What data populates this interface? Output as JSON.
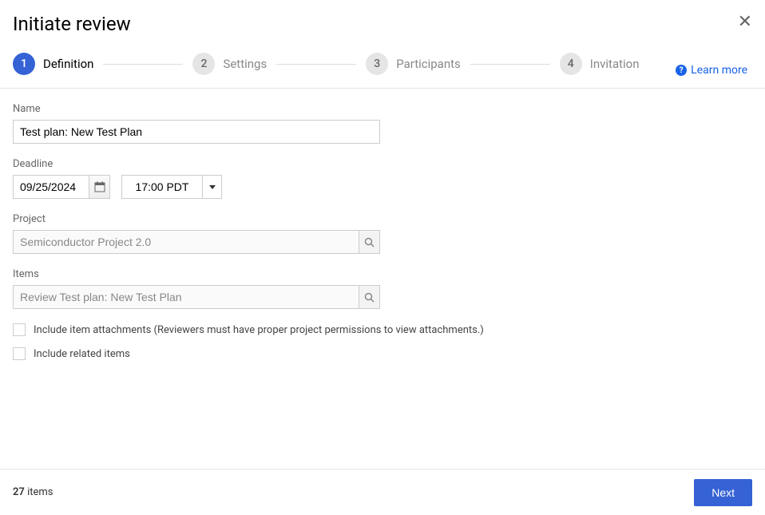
{
  "header": {
    "title": "Initiate review"
  },
  "stepper": {
    "steps": [
      {
        "num": "1",
        "label": "Definition",
        "active": true
      },
      {
        "num": "2",
        "label": "Settings",
        "active": false
      },
      {
        "num": "3",
        "label": "Participants",
        "active": false
      },
      {
        "num": "4",
        "label": "Invitation",
        "active": false
      }
    ],
    "learn_more": "Learn more"
  },
  "form": {
    "name_label": "Name",
    "name_value": "Test plan: New Test Plan",
    "deadline_label": "Deadline",
    "deadline_date": "09/25/2024",
    "deadline_time": "17:00 PDT",
    "project_label": "Project",
    "project_placeholder": "Semiconductor Project 2.0",
    "items_label": "Items",
    "items_placeholder": "Review Test plan: New Test Plan",
    "include_attachments_label": "Include item attachments (Reviewers must have proper project permissions to view attachments.)",
    "include_related_label": "Include related items"
  },
  "footer": {
    "count": "27",
    "count_suffix": " items",
    "next_label": "Next"
  }
}
